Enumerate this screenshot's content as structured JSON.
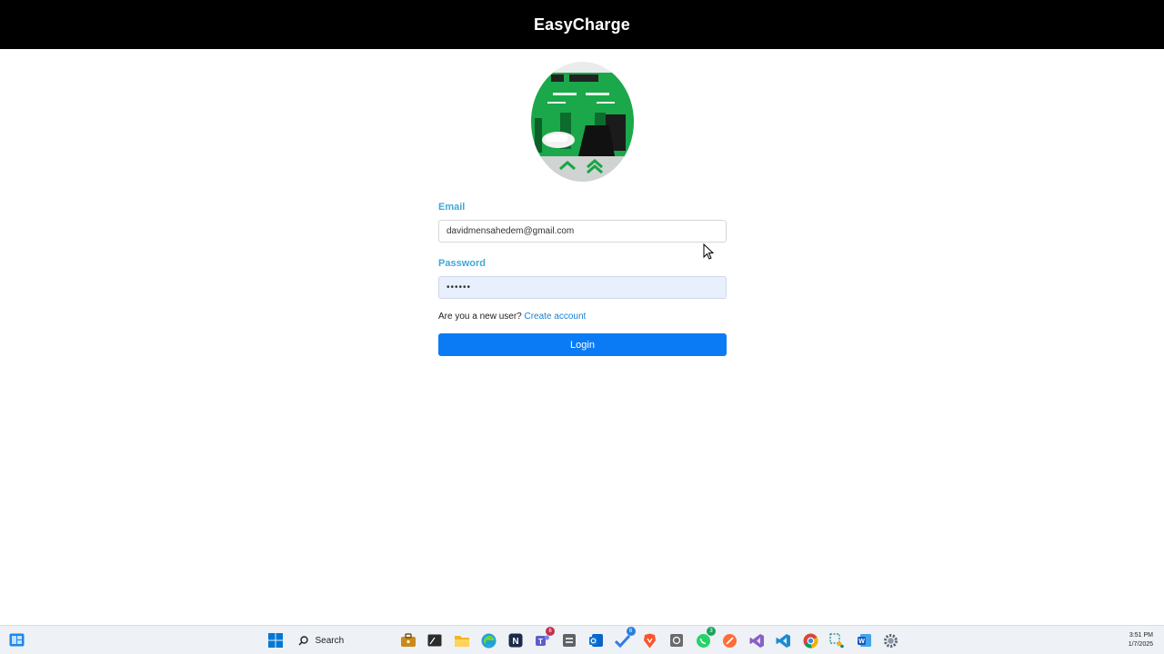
{
  "header": {
    "title": "EasyCharge"
  },
  "form": {
    "email_label": "Email",
    "email_value": "davidmensahedem@gmail.com",
    "password_label": "Password",
    "password_value": "••••••",
    "signup_prompt": "Are you a new user?",
    "signup_link": "Create account",
    "login_label": "Login"
  },
  "colors": {
    "header_bg": "#000000",
    "label_color": "#3fa9d6",
    "link_color": "#1a7fd6",
    "button_bg": "#0b7bf5",
    "logo_green": "#1db954"
  },
  "taskbar": {
    "search_label": "Search",
    "icons": [
      "widgets-icon",
      "windows-start-icon",
      "search-icon",
      "briefcase-icon",
      "terminal-icon",
      "file-explorer-icon",
      "edge-icon",
      "notion-icon",
      "teams-icon",
      "stack-icon",
      "outlook-icon",
      "todo-icon",
      "brave-icon",
      "screenshot-icon",
      "whatsapp-icon",
      "postman-icon",
      "visual-studio-icon",
      "vscode-icon",
      "chrome-icon",
      "snipping-tool-icon",
      "word-icon",
      "settings-icon"
    ],
    "badges": {
      "teams": "6",
      "todo": "6",
      "whatsapp": "3"
    },
    "time": "3:51 PM",
    "date": "1/7/2025"
  }
}
